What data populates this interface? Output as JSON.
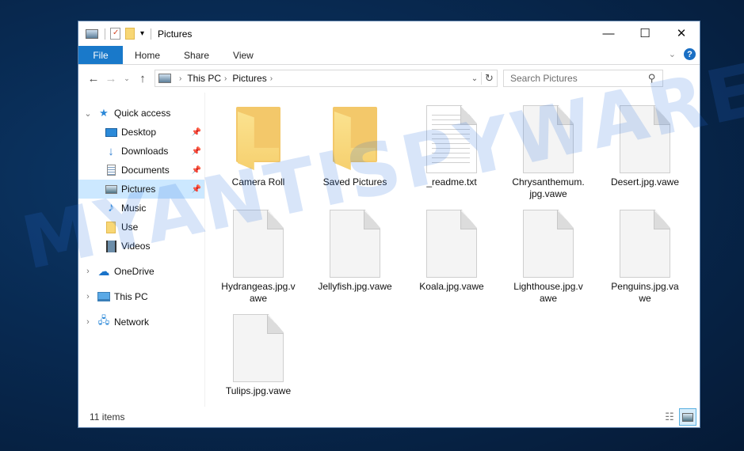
{
  "window": {
    "title": "Pictures",
    "controls": {
      "minimize": "—",
      "maximize": "☐",
      "close": "✕"
    }
  },
  "quick_access_toolbar": {
    "icons": [
      "properties-icon",
      "new-folder-icon",
      "customize-dropdown-icon"
    ]
  },
  "ribbon": {
    "tabs": [
      {
        "label": "File",
        "active": true
      },
      {
        "label": "Home"
      },
      {
        "label": "Share"
      },
      {
        "label": "View"
      }
    ],
    "help_label": "?",
    "expand_glyph": "⌄"
  },
  "navigation": {
    "back": "←",
    "forward": "→",
    "recent": "⌄",
    "up": "↑",
    "breadcrumb": [
      "This PC",
      "Pictures"
    ],
    "refresh": "↻",
    "dropdown": "⌄"
  },
  "search": {
    "placeholder": "Search Pictures",
    "value": ""
  },
  "sidebar": {
    "quick_access": {
      "label": "Quick access",
      "expanded": true
    },
    "items": [
      {
        "label": "Desktop",
        "icon": "desktop-icon",
        "pinned": true
      },
      {
        "label": "Downloads",
        "icon": "downloads-icon",
        "pinned": true
      },
      {
        "label": "Documents",
        "icon": "documents-icon",
        "pinned": true
      },
      {
        "label": "Pictures",
        "icon": "pictures-icon",
        "pinned": true,
        "selected": true
      },
      {
        "label": "Music",
        "icon": "music-icon"
      },
      {
        "label": "Use",
        "icon": "folder-icon"
      },
      {
        "label": "Videos",
        "icon": "videos-icon"
      }
    ],
    "roots": [
      {
        "label": "OneDrive",
        "icon": "onedrive-icon"
      },
      {
        "label": "This PC",
        "icon": "this-pc-icon"
      },
      {
        "label": "Network",
        "icon": "network-icon"
      }
    ]
  },
  "files": [
    {
      "name": "Camera Roll",
      "type": "folder"
    },
    {
      "name": "Saved Pictures",
      "type": "folder"
    },
    {
      "name": "_readme.txt",
      "type": "text"
    },
    {
      "name": "Chrysanthemum.\njpg.vawe",
      "type": "file"
    },
    {
      "name": "Desert.jpg.vawe",
      "type": "file"
    },
    {
      "name": "Hydrangeas.jpg.v\nawe",
      "type": "file"
    },
    {
      "name": "Jellyfish.jpg.vawe",
      "type": "file"
    },
    {
      "name": "Koala.jpg.vawe",
      "type": "file"
    },
    {
      "name": "Lighthouse.jpg.v\nawe",
      "type": "file"
    },
    {
      "name": "Penguins.jpg.va\nwe",
      "type": "file"
    },
    {
      "name": "Tulips.jpg.vawe",
      "type": "file"
    }
  ],
  "status": {
    "item_count": "11 items"
  },
  "watermark": "MYANTISPYWARE.COM",
  "colors": {
    "accent": "#1979ca",
    "selected": "#cce8ff",
    "folder": "#f6d06f"
  }
}
